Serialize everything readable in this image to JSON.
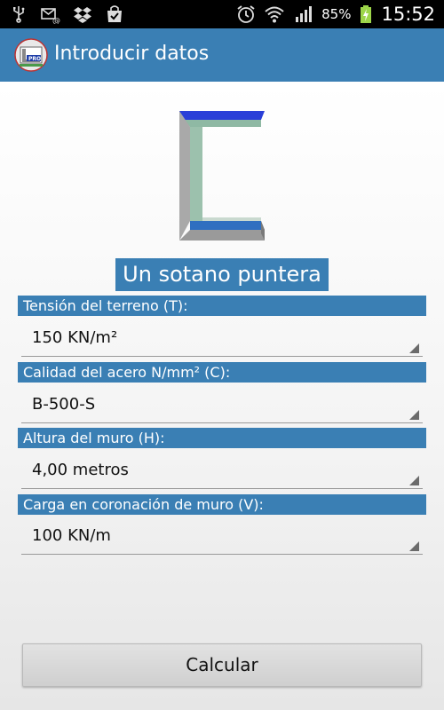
{
  "status_bar": {
    "battery_percent": "85%",
    "time": "15:52",
    "icons": [
      "usb-icon",
      "email-icon",
      "dropbox-icon",
      "bag-icon",
      "alarm-icon",
      "wifi-icon",
      "signal-icon",
      "battery-charging-icon"
    ]
  },
  "action_bar": {
    "title": "Introducir datos",
    "color": "#3a7fb4"
  },
  "wall": {
    "title": "Un sotano puntera"
  },
  "fields": [
    {
      "label": "Tensión del terreno (T):",
      "value": "150 KN/m²"
    },
    {
      "label": "Calidad del acero N/mm² (C):",
      "value": "B-500-S"
    },
    {
      "label": "Altura del muro (H):",
      "value": "4,00 metros"
    },
    {
      "label": "Carga en coronación de muro (V):",
      "value": "100 KN/m"
    }
  ],
  "button": {
    "label": "Calcular"
  }
}
